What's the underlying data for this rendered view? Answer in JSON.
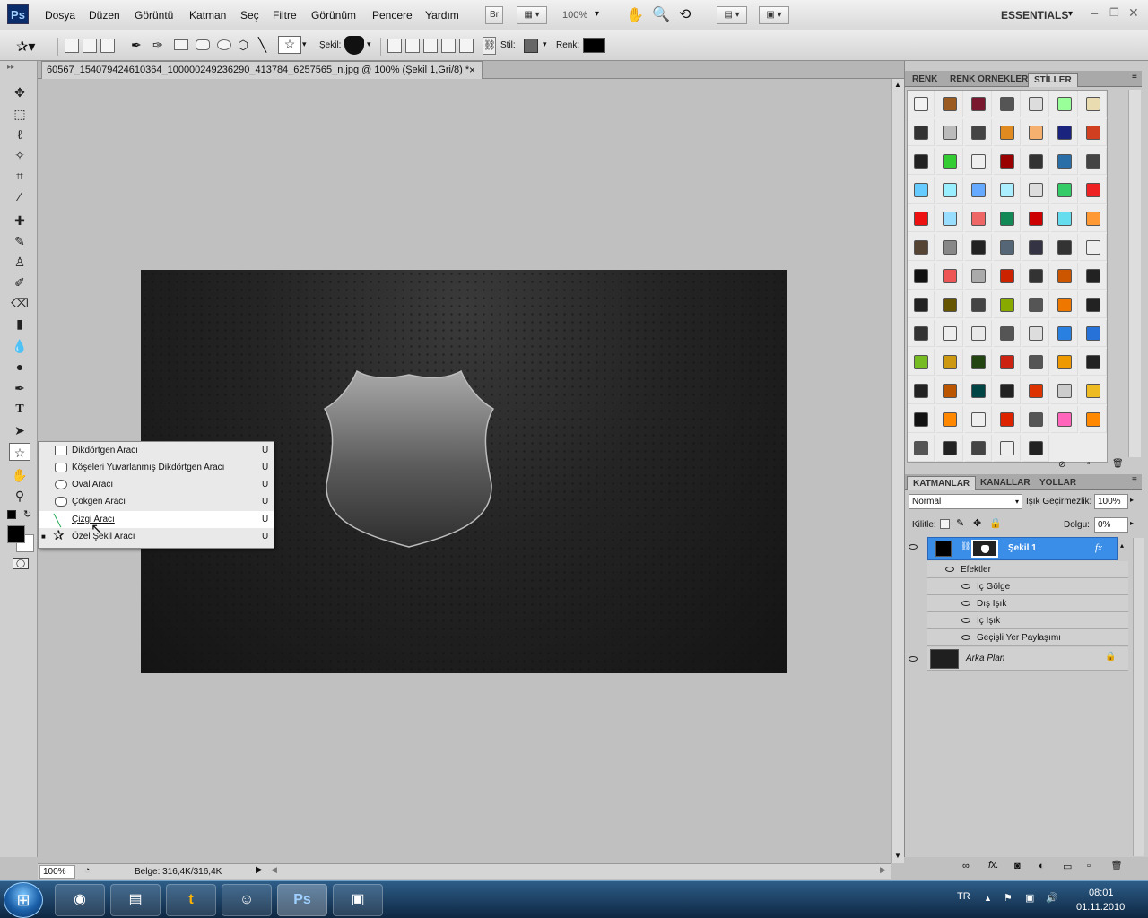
{
  "app": {
    "logo": "Ps",
    "workspace": "ESSENTIALS"
  },
  "menu": [
    "Dosya",
    "Düzen",
    "Görüntü",
    "Katman",
    "Seç",
    "Filtre",
    "Görünüm",
    "Pencere",
    "Yardım"
  ],
  "topbar": {
    "bridge": "Br",
    "zoom": "100%"
  },
  "options": {
    "shape_label": "Şekil:",
    "style_label": "Stil:",
    "color_label": "Renk:"
  },
  "document": {
    "tab_title": "60567_154079424610364_100000249236290_413784_6257565_n.jpg @ 100% (Şekil 1,Gri/8) *",
    "close": "×"
  },
  "shape_menu": [
    {
      "label": "Dikdörtgen Aracı",
      "key": "U"
    },
    {
      "label": "Köşeleri Yuvarlanmış Dikdörtgen Aracı",
      "key": "U"
    },
    {
      "label": "Oval Aracı",
      "key": "U"
    },
    {
      "label": "Çokgen Aracı",
      "key": "U"
    },
    {
      "label": "Çizgi Aracı",
      "key": "U"
    },
    {
      "label": "Özel Şekil Aracı",
      "key": "U"
    }
  ],
  "status": {
    "zoom": "100%",
    "doc_size": "Belge: 316,4K/316,4K"
  },
  "styles_panel": {
    "tabs": [
      "RENK",
      "RENK ÖRNEKLERİ",
      "STİLLER"
    ]
  },
  "layers_panel": {
    "tabs": [
      "KATMANLAR",
      "KANALLAR",
      "YOLLAR"
    ],
    "blend_mode": "Normal",
    "opacity_label": "Işık Geçirmezlik:",
    "opacity_value": "100%",
    "lock_label": "Kilitle:",
    "fill_label": "Dolgu:",
    "fill_value": "0%",
    "layer1_name": "Şekil 1",
    "fx": "fx",
    "effects_label": "Efektler",
    "effects": [
      "İç Gölge",
      "Dış Işık",
      "İç Işık",
      "Geçişli Yer Paylaşımı"
    ],
    "background_name": "Arka Plan"
  },
  "taskbar": {
    "lang": "TR",
    "time": "08:01",
    "date": "01.11.2010"
  },
  "swatch_colors": [
    "#f2f2f2",
    "#9a5a20",
    "#7a1830",
    "#555",
    "#ddd",
    "#9f9",
    "#e8dcb0",
    "#333",
    "#bbb",
    "#444",
    "#e08a20",
    "#f5b070",
    "#1a237e",
    "#d04020",
    "#222",
    "#3c3",
    "#eee",
    "#900",
    "#333",
    "#2a6fa8",
    "#444",
    "#6cf",
    "#9ef",
    "#6af",
    "#aef",
    "#ddd",
    "#3c6",
    "#e22",
    "#e11",
    "#9df",
    "#e66",
    "#185",
    "#c00",
    "#6de",
    "#f93",
    "#543",
    "#888",
    "#222",
    "#567",
    "#334",
    "#333",
    "#eee",
    "#111",
    "#e55",
    "#aaa",
    "#c20",
    "#333",
    "#c50",
    "#222",
    "#222",
    "#650",
    "#444",
    "#8a0",
    "#555",
    "#e70",
    "#222",
    "#333",
    "#eee",
    "#e9e9e9",
    "#555",
    "#ddd",
    "#2980e0",
    "#2672d8",
    "#7b2",
    "#c91",
    "#241",
    "#c21",
    "#555",
    "#e90",
    "#222",
    "#222",
    "#b50",
    "#044",
    "#222",
    "#d30",
    "#ccc",
    "#eb2",
    "#111",
    "#f80",
    "#eee",
    "#d20",
    "#555",
    "#f6b",
    "#f80",
    "#555",
    "#222",
    "#444",
    "#eee",
    "#222"
  ]
}
